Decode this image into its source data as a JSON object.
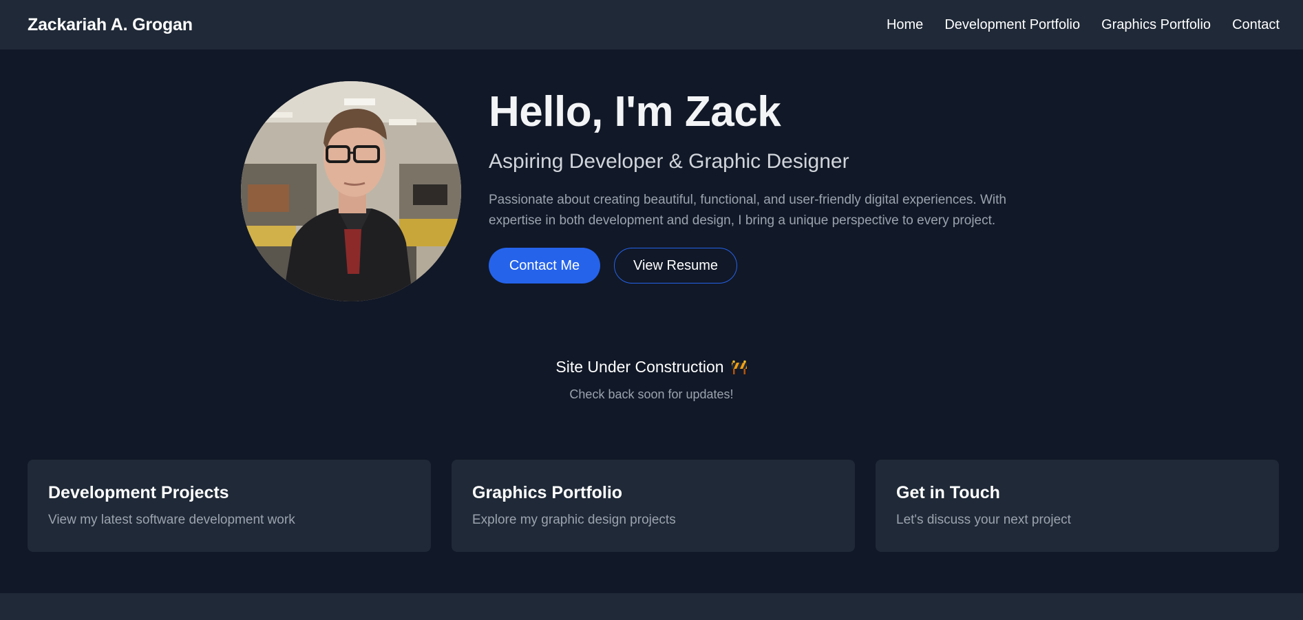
{
  "navbar": {
    "brand": "Zackariah A. Grogan",
    "links": [
      "Home",
      "Development Portfolio",
      "Graphics Portfolio",
      "Contact"
    ]
  },
  "hero": {
    "title": "Hello, I'm Zack",
    "subtitle": "Aspiring Developer & Graphic Designer",
    "description": "Passionate about creating beautiful, functional, and user-friendly digital experiences. With expertise in both development and design, I bring a unique perspective to every project.",
    "contact_button": "Contact Me",
    "resume_button": "View Resume"
  },
  "construction": {
    "title": "Site Under Construction",
    "icon": "construction-barrier-icon",
    "subtitle": "Check back soon for updates!"
  },
  "cards": [
    {
      "title": "Development Projects",
      "description": "View my latest software development work"
    },
    {
      "title": "Graphics Portfolio",
      "description": "Explore my graphic design projects"
    },
    {
      "title": "Get in Touch",
      "description": "Let's discuss your next project"
    }
  ],
  "colors": {
    "background": "#111827",
    "surface": "#1f2937",
    "accent": "#2563eb",
    "muted_text": "#9ca3af"
  }
}
